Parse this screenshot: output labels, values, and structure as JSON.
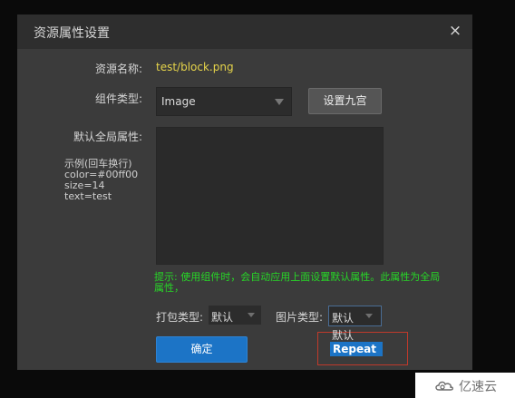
{
  "dialog": {
    "title": "资源属性设置",
    "close_icon": "close-icon",
    "close_glyph": "×"
  },
  "resource": {
    "label": "资源名称:",
    "value": "test/block.png"
  },
  "component": {
    "label": "组件类型:",
    "selected": "Image",
    "nine_grid_button": "设置九宫"
  },
  "default_props": {
    "label": "默认全局属性:",
    "example_lines": [
      "示例(回车换行)",
      "color=#00ff00",
      "size=14",
      "text=test"
    ],
    "textarea_value": ""
  },
  "tip": "提示: 使用组件时，会自动应用上面设置默认属性。此属性为全局属性，",
  "pack_type": {
    "label": "打包类型:",
    "selected": "默认"
  },
  "image_type": {
    "label": "图片类型:",
    "selected": "默认",
    "options": [
      "默认",
      "Repeat"
    ]
  },
  "confirm_button": "确定",
  "watermark": {
    "text": "亿速云",
    "icon": "cloud-logo-icon"
  },
  "colors": {
    "accent": "#1c74c6",
    "resource_value": "#e6d44a",
    "tip": "#27d727",
    "highlight_box": "#c0392b"
  }
}
